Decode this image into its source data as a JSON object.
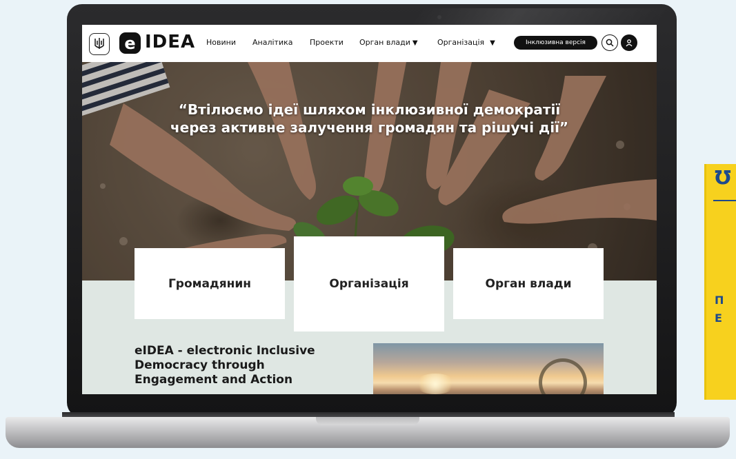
{
  "header": {
    "logo_text": "IDEA",
    "logo_letter": "e",
    "nav": [
      {
        "label": "Новини",
        "dropdown": false
      },
      {
        "label": "Аналітика",
        "dropdown": false
      },
      {
        "label": "Проекти",
        "dropdown": false
      },
      {
        "label": "Орган влади",
        "dropdown": true
      },
      {
        "label": "Організація",
        "dropdown": true
      }
    ],
    "inclusive_button": "Інклюзивна версія"
  },
  "hero": {
    "quote_line1": "“Втілюємо ідеї шляхом інклюзивної демократії",
    "quote_line2": "через активне залучення громадян та рішучі дії”"
  },
  "cards": [
    {
      "label": "Громадянин"
    },
    {
      "label": "Організація"
    },
    {
      "label": "Орган влади"
    }
  ],
  "about": {
    "title_line1": "eIDEA - electronic Inclusive",
    "title_line2": "Democracy through",
    "title_line3": "Engagement and Action"
  },
  "poster": {
    "logo": "Ʊ",
    "line1": "П",
    "line2": "Е"
  },
  "colors": {
    "accent": "#111111",
    "poster_yellow": "#f7d11e",
    "poster_blue": "#1e4a8c",
    "lower_section": "#dfe7e3"
  },
  "icons": [
    "trident-icon",
    "search-icon",
    "user-icon",
    "chevron-down-icon"
  ]
}
